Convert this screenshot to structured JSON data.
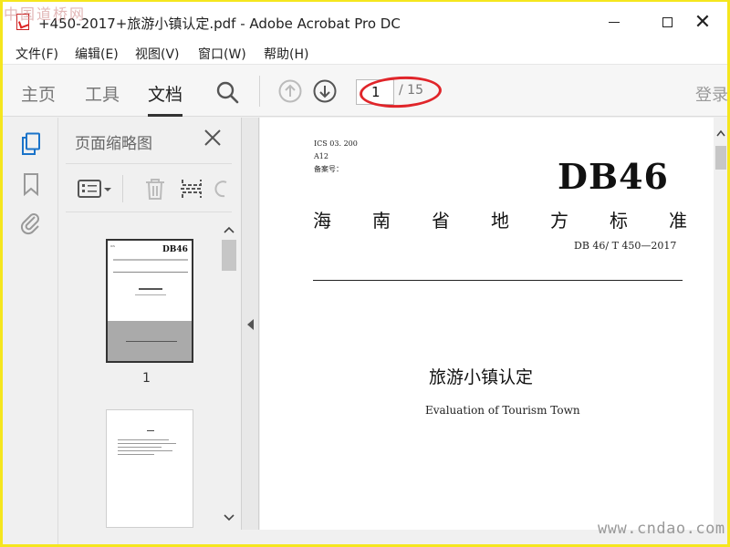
{
  "watermark_top": "中国道桥网",
  "watermark_bottom": "www.cndao.com",
  "titlebar": {
    "title": "+450-2017+旅游小镇认定.pdf - Adobe Acrobat Pro DC",
    "close_glyph": "✕"
  },
  "menu": {
    "items": [
      "文件(F)",
      "编辑(E)",
      "视图(V)",
      "窗口(W)",
      "帮助(H)"
    ]
  },
  "toolbar": {
    "tabs": [
      "主页",
      "工具",
      "文档"
    ],
    "active_tab": "文档",
    "current_page": "1",
    "total_pages": "/ 15",
    "login": "登录"
  },
  "thumbnails": {
    "title": "页面缩略图",
    "page_labels": [
      "1"
    ],
    "thumb1_db": "DB46"
  },
  "document": {
    "ics": "ICS  03. 200",
    "a12": "A12",
    "record": "备案号：",
    "db": "DB46",
    "province_chars": [
      "海",
      "南",
      "省",
      "地",
      "方",
      "标",
      "准"
    ],
    "code": "DB 46/  T  450—2017",
    "title": "旅游小镇认定",
    "subtitle": "Evaluation of Tourism Town"
  },
  "colors": {
    "annotation_oval": "#e0252a",
    "frame": "#f5e61e",
    "rail_active": "#1a73c9"
  }
}
